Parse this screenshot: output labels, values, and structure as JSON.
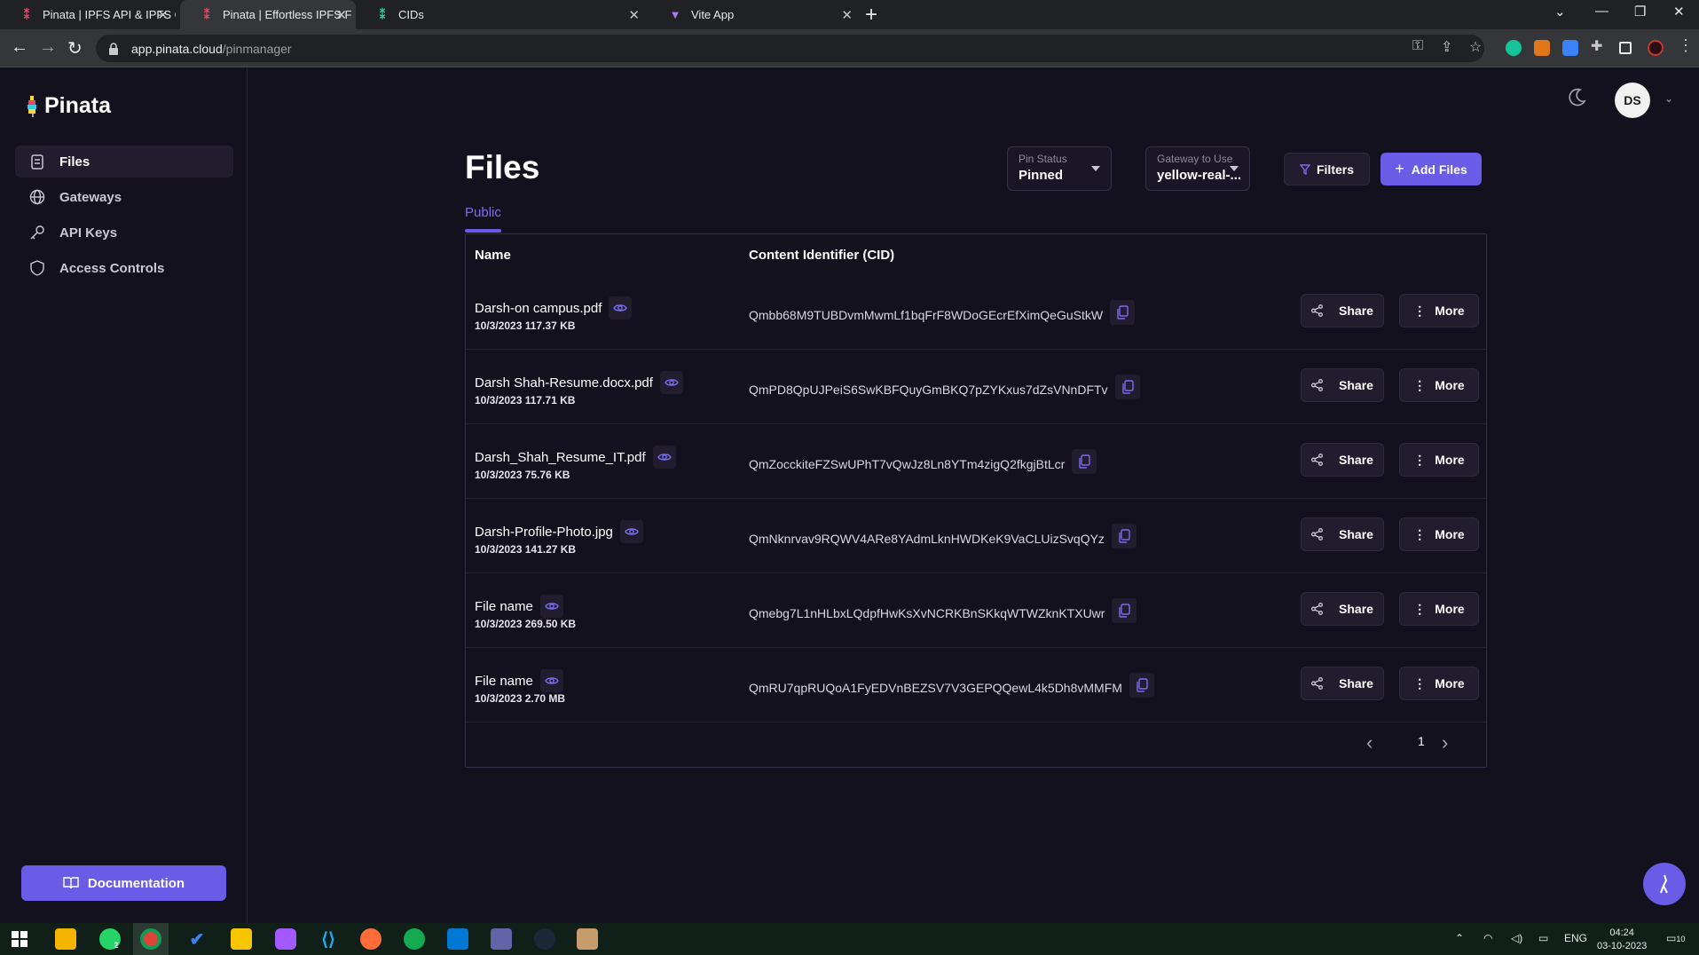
{
  "browser": {
    "tabs": [
      {
        "title": "Pinata | IPFS API & IPFS Gateway",
        "active": false
      },
      {
        "title": "Pinata | Effortless IPFS File Mana",
        "active": true
      },
      {
        "title": "CIDs",
        "active": false
      },
      {
        "title": "Vite App",
        "active": false
      }
    ],
    "url_host": "app.pinata.cloud",
    "url_path": "/pinmanager"
  },
  "sidebar": {
    "brand": "Pinata",
    "items": [
      {
        "label": "Files",
        "icon": "file-icon",
        "active": true
      },
      {
        "label": "Gateways",
        "icon": "globe-icon",
        "active": false
      },
      {
        "label": "API Keys",
        "icon": "key-icon",
        "active": false
      },
      {
        "label": "Access Controls",
        "icon": "shield-icon",
        "active": false
      }
    ],
    "documentation_label": "Documentation"
  },
  "header": {
    "avatar_initials": "DS"
  },
  "page": {
    "title": "Files",
    "tab_label": "Public",
    "pin_status": {
      "label": "Pin Status",
      "value": "Pinned"
    },
    "gateway": {
      "label": "Gateway to Use",
      "value": "yellow-real-..."
    },
    "filters_label": "Filters",
    "add_files_label": "Add Files"
  },
  "table": {
    "columns": [
      "Name",
      "Content Identifier (CID)"
    ],
    "rows": [
      {
        "name": "Darsh-on campus.pdf",
        "meta": "10/3/2023 117.37 KB",
        "cid": "Qmbb68M9TUBDvmMwmLf1bqFrF8WDoGEcrEfXimQeGuStkW"
      },
      {
        "name": "Darsh Shah-Resume.docx.pdf",
        "meta": "10/3/2023 117.71 KB",
        "cid": "QmPD8QpUJPeiS6SwKBFQuyGmBKQ7pZYKxus7dZsVNnDFTv"
      },
      {
        "name": "Darsh_Shah_Resume_IT.pdf",
        "meta": "10/3/2023 75.76 KB",
        "cid": "QmZocckiteFZSwUPhT7vQwJz8Ln8YTm4zigQ2fkgjBtLcr"
      },
      {
        "name": "Darsh-Profile-Photo.jpg",
        "meta": "10/3/2023 141.27 KB",
        "cid": "QmNknrvav9RQWV4ARe8YAdmLknHWDKeK9VaCLUizSvqQYz"
      },
      {
        "name": "File name",
        "meta": "10/3/2023 269.50 KB",
        "cid": "Qmebg7L1nHLbxLQdpfHwKsXvNCRKBnSKkqWTWZknKTXUwr"
      },
      {
        "name": "File name",
        "meta": "10/3/2023 2.70 MB",
        "cid": "QmRU7qpRUQoA1FyEDVnBEZSV7V3GEPQQewL4k5Dh8vMMFM"
      }
    ],
    "share_label": "Share",
    "more_label": "More",
    "page_number": "1"
  },
  "taskbar": {
    "language": "ENG",
    "time": "04:24",
    "date": "03-10-2023",
    "whatsapp_badge": "2",
    "notification_count": "10"
  },
  "colors": {
    "accent": "#6b5ce7",
    "background": "#14111f",
    "surface": "#211d2e"
  }
}
